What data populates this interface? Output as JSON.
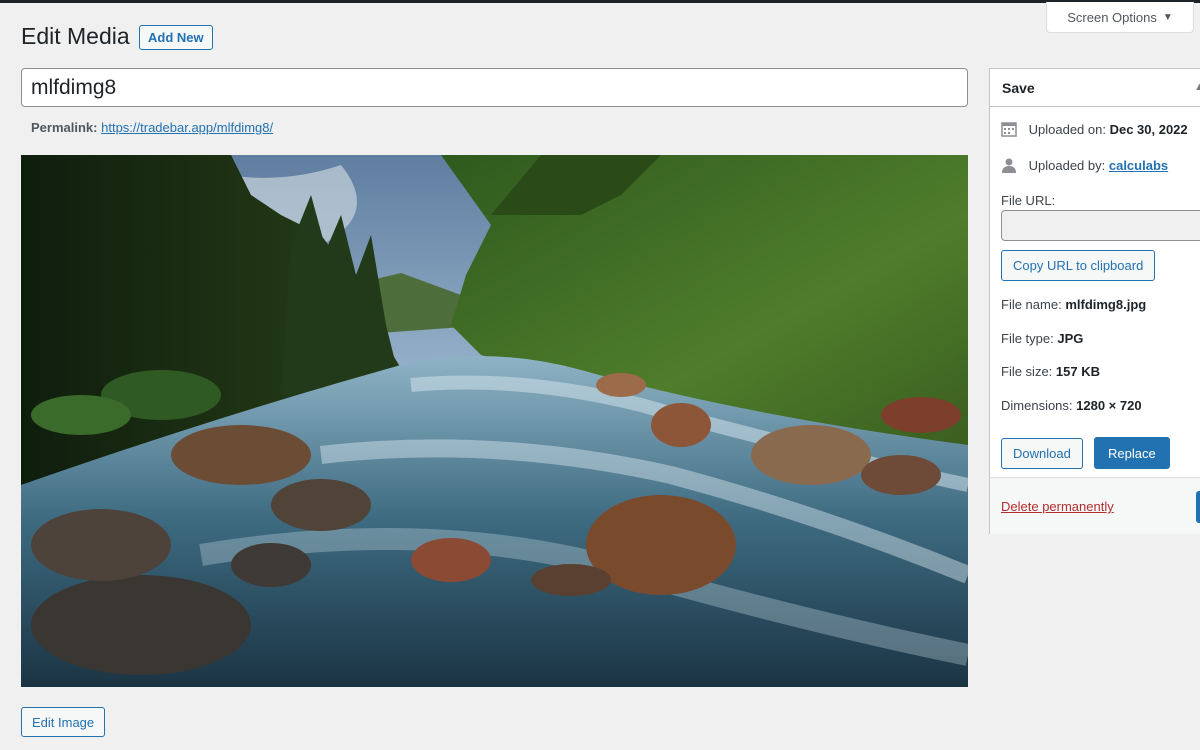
{
  "header": {
    "screen_options_label": "Screen Options",
    "page_title": "Edit Media",
    "add_new_label": "Add New"
  },
  "media": {
    "title_value": "mlfdimg8",
    "permalink_label": "Permalink:",
    "permalink_url": "https://tradebar.app/mlfdimg8/",
    "edit_image_label": "Edit Image"
  },
  "save_box": {
    "title": "Save",
    "uploaded_on_label": "Uploaded on:",
    "uploaded_on_value": "Dec 30, 2022",
    "uploaded_by_label": "Uploaded by:",
    "uploaded_by_value": "calculabs",
    "file_url_label": "File URL:",
    "file_url_value": "",
    "copy_url_label": "Copy URL to clipboard",
    "file_name_label": "File name:",
    "file_name_value": "mlfdimg8.jpg",
    "file_type_label": "File type:",
    "file_type_value": "JPG",
    "file_size_label": "File size:",
    "file_size_value": "157 KB",
    "dimensions_label": "Dimensions:",
    "dimensions_value": "1280 × 720",
    "download_label": "Download",
    "replace_label": "Replace",
    "delete_label": "Delete permanently"
  },
  "colors": {
    "accent": "#2271b1",
    "danger": "#b32d2e",
    "background": "#f0f0f1"
  },
  "icons": {
    "calendar": "calendar-icon",
    "user": "user-icon",
    "dropdown": "triangle-down-icon"
  }
}
